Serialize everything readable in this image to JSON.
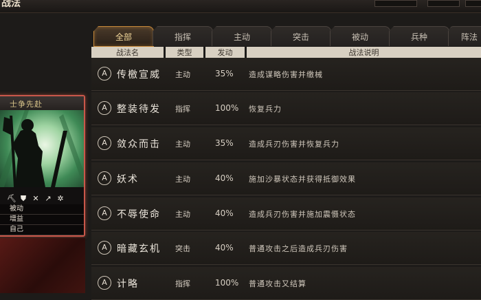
{
  "header": {
    "title": "战法"
  },
  "card": {
    "title": "士争先赴",
    "icons": [
      "axe-icon",
      "shield-icon",
      "crossed-swords-icon",
      "spear-icon",
      "wheel-icon"
    ],
    "icon_glyphs": [
      "⛏",
      "⛊",
      "✕",
      "↗",
      "✲"
    ],
    "tags": [
      "被动",
      "增益",
      "自己"
    ]
  },
  "tabs": [
    {
      "label": "全部",
      "active": true
    },
    {
      "label": "指挥",
      "active": false
    },
    {
      "label": "主动",
      "active": false
    },
    {
      "label": "突击",
      "active": false
    },
    {
      "label": "被动",
      "active": false
    },
    {
      "label": "兵种",
      "active": false
    },
    {
      "label": "阵法",
      "active": false
    }
  ],
  "table": {
    "columns": [
      "战法名",
      "类型",
      "发动",
      "战法说明"
    ],
    "rows": [
      {
        "grade": "A",
        "name": "传檄宣威",
        "type": "主动",
        "rate": "35%",
        "desc": "造成谋略伤害并缴械"
      },
      {
        "grade": "A",
        "name": "整装待发",
        "type": "指挥",
        "rate": "100%",
        "desc": "恢复兵力"
      },
      {
        "grade": "A",
        "name": "敛众而击",
        "type": "主动",
        "rate": "35%",
        "desc": "造成兵刃伤害并恢复兵力"
      },
      {
        "grade": "A",
        "name": "妖术",
        "type": "主动",
        "rate": "40%",
        "desc": "施加沙暴状态并获得抵御效果"
      },
      {
        "grade": "A",
        "name": "不辱使命",
        "type": "主动",
        "rate": "40%",
        "desc": "造成兵刃伤害并施加震慑状态"
      },
      {
        "grade": "A",
        "name": "暗藏玄机",
        "type": "突击",
        "rate": "40%",
        "desc": "普通攻击之后造成兵刃伤害"
      },
      {
        "grade": "A",
        "name": "计略",
        "type": "指挥",
        "rate": "100%",
        "desc": "普通攻击又结算"
      }
    ]
  }
}
